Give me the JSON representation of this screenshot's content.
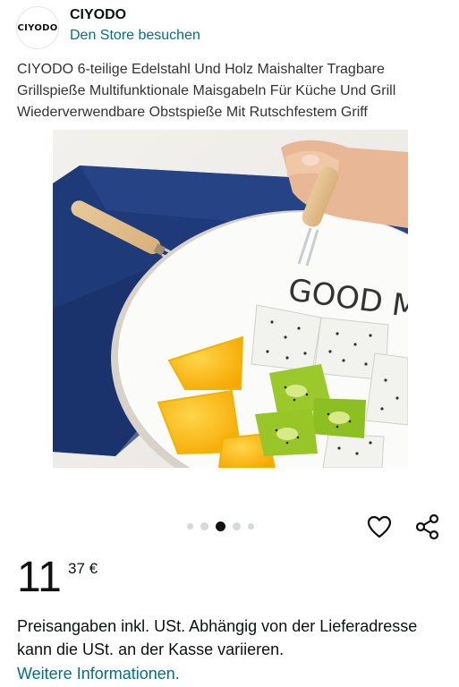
{
  "store": {
    "logo_text": "CIYODO",
    "name": "CIYODO",
    "link_label": "Den Store besuchen"
  },
  "product": {
    "title": "CIYODO 6-teilige Edelstahl Und Holz Maishalter Tragbare Grillspieße Multifunktionale Maisgabeln Für Küche Und Grill Wiederverwendbare Obstspieße Mit Rutschfestem Griff",
    "image_plate_text": "GOOD MO"
  },
  "carousel": {
    "dot_count": 5,
    "active_index": 2
  },
  "actions": {
    "wishlist_icon": "heart-icon",
    "share_icon": "share-icon"
  },
  "price": {
    "whole": "11",
    "fraction": "37 €"
  },
  "tax": {
    "note": "Preisangaben inkl. USt. Abhängig von der Lieferadresse kann die USt. an der Kasse variieren.",
    "more_info_link": "Weitere Informationen."
  },
  "colors": {
    "link": "#007185",
    "text": "#0f1111",
    "active_dot": "#111111",
    "inactive_dot": "#d5d9d9"
  }
}
